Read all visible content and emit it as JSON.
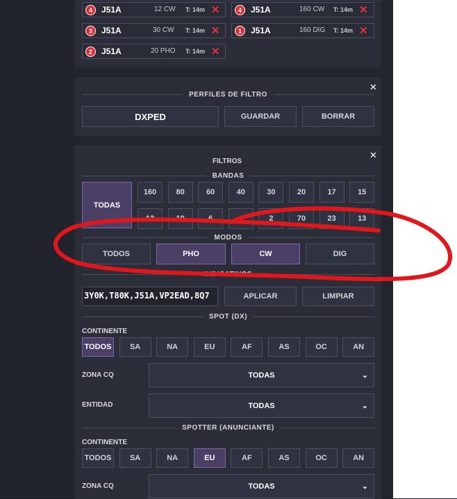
{
  "spots": [
    {
      "rank": "4",
      "call": "J51A",
      "freq": "12 CW",
      "time": "T: 14m"
    },
    {
      "rank": "4",
      "call": "J51A",
      "freq": "160 CW",
      "time": "T: 14m"
    },
    {
      "rank": "3",
      "call": "J51A",
      "freq": "30 CW",
      "time": "T: 14m"
    },
    {
      "rank": "1",
      "call": "J51A",
      "freq": "160 DIG",
      "time": "T: 14m"
    },
    {
      "rank": "2",
      "call": "J51A",
      "freq": "20 PHO",
      "time": "T: 14m"
    }
  ],
  "delete_glyph": "✕",
  "close_glyph": "✕",
  "perfiles": {
    "title": "PERFILES DE FILTRO",
    "profile": "DXPED",
    "save": "GUARDAR",
    "delete": "BORRAR"
  },
  "filtros": {
    "title": "FILTROS",
    "bandas_title": "BANDAS",
    "todas": "TODAS",
    "bands_row1": [
      "160",
      "80",
      "60",
      "40",
      "30",
      "20",
      "17",
      "15"
    ],
    "bands_row2": [
      "12",
      "10",
      "6",
      "4",
      "2",
      "70",
      "23",
      "13"
    ],
    "modos_title": "MODOS",
    "modes": [
      "TODOS",
      "PHO",
      "CW",
      "DIG"
    ],
    "indicativos_title": "INDICATIVOS",
    "indicativos_value": "3Y0K,T80K,J51A,VP2EAD,8Q7",
    "apply": "APLICAR",
    "clear": "LIMPIAR",
    "spot_title": "SPOT (DX)",
    "continente_label": "CONTINENTE",
    "continents": [
      "TODOS",
      "SA",
      "NA",
      "EU",
      "AF",
      "AS",
      "OC",
      "AN"
    ],
    "zona_label": "ZONA CQ",
    "zona_value": "TODAS",
    "entidad_label": "ENTIDAD",
    "entidad_value": "TODAS",
    "spotter_title": "SPOTTER (ANUNCIANTE)",
    "spotter_continente_label": "CONTINENTE",
    "spotter_zona_label": "ZONA CQ",
    "spotter_zona_value": "TODAS",
    "chevron": "⌄"
  },
  "colors": {
    "accent": "#4b3f66",
    "danger": "#d9303a",
    "annotation": "#e3161c"
  }
}
